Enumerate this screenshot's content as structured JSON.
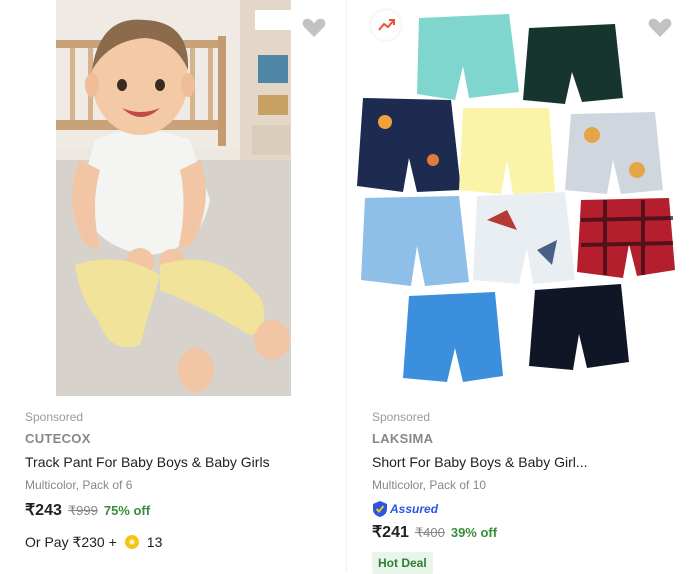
{
  "products": [
    {
      "sponsored": "Sponsored",
      "brand": "CUTECOX",
      "title": "Track Pant For Baby Boys & Baby Girls",
      "variant": "Multicolor, Pack of 6",
      "price": "₹243",
      "mrp": "₹999",
      "discount": "75% off",
      "pay_text": "Or Pay ₹230 +",
      "coins": "13"
    },
    {
      "sponsored": "Sponsored",
      "brand": "LAKSIMA",
      "title": "Short For Baby Boys & Baby Girl...",
      "variant": "Multicolor, Pack of 10",
      "assured": "Assured",
      "price": "₹241",
      "mrp": "₹400",
      "discount": "39% off",
      "deal": "Hot Deal"
    }
  ],
  "colors": {
    "discount": "#388e3c",
    "assured": "#2a55e5",
    "deal_bg": "#e8f6ea"
  },
  "icons": [
    "heart-icon",
    "trending-icon",
    "assured-shield-icon",
    "coin-icon"
  ]
}
